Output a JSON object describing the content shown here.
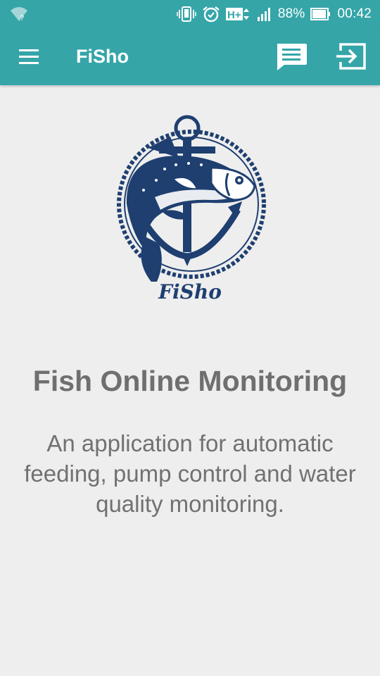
{
  "status_bar": {
    "wifi_icon": "wifi-unknown-icon",
    "wifi_badge": "?",
    "network_type": "H+",
    "battery": "88%",
    "time": "00:42",
    "icons": [
      "vibrate-icon",
      "alarm-icon",
      "network-type-icon",
      "signal-icon",
      "battery-icon"
    ]
  },
  "app_bar": {
    "title": "FiSho",
    "icons": [
      "menu-icon",
      "chat-icon",
      "logout-icon"
    ]
  },
  "logo": {
    "text": "FiSho",
    "icon": "fish-anchor-logo",
    "color": "#1e3f70"
  },
  "main": {
    "headline": "Fish Online Monitoring",
    "description": "An application for automatic feeding, pump control and water quality monitoring."
  },
  "colors": {
    "primary": "#35a5a8",
    "background": "#eeeeee",
    "text": "#6f6f6f",
    "logo": "#1e3f70"
  }
}
